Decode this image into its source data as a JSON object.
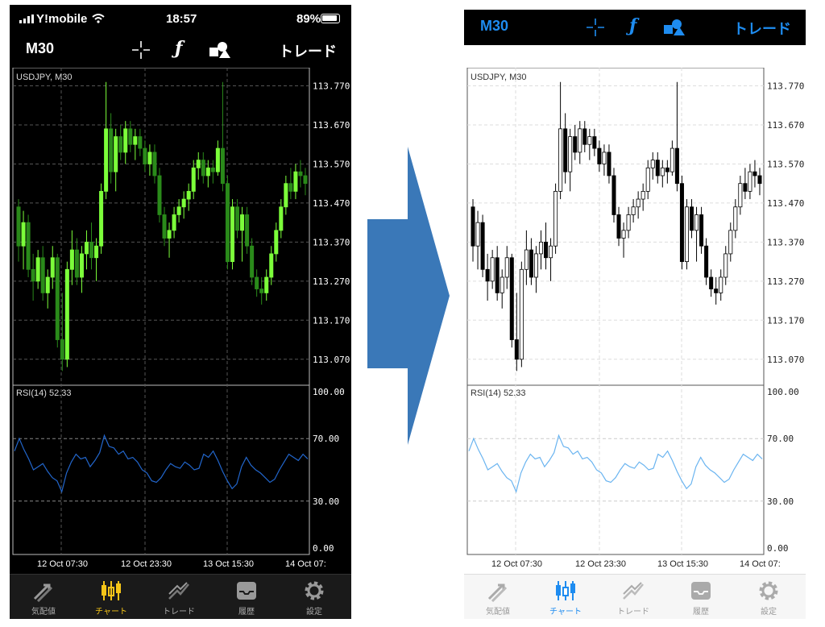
{
  "status": {
    "carrier": "Y!mobile",
    "time": "18:57",
    "battery": "89%"
  },
  "toolbar": {
    "timeframe": "M30",
    "crosshair_icon": "crosshair-icon",
    "indicators_icon": "function-f-icon",
    "objects_icon": "shapes-icon",
    "trade_label": "トレード"
  },
  "chart": {
    "symbol_label": "USDJPY, M30",
    "price_ticks": [
      "113.770",
      "113.670",
      "113.570",
      "113.470",
      "113.370",
      "113.270",
      "113.170",
      "113.070"
    ],
    "rsi_label": "RSI(14) 52.33",
    "rsi_ticks": [
      "100.00",
      "70.00",
      "30.00",
      "0.00"
    ],
    "time_ticks": [
      "12 Oct 07:30",
      "12 Oct 23:30",
      "13 Oct 15:30",
      "14 Oct 07:"
    ]
  },
  "tabs": [
    {
      "label": "気配値",
      "icon": "quotes-arrows-icon"
    },
    {
      "label": "チャート",
      "icon": "candlestick-icon"
    },
    {
      "label": "トレード",
      "icon": "trade-chart-icon"
    },
    {
      "label": "履歴",
      "icon": "history-inbox-icon"
    },
    {
      "label": "設定",
      "icon": "gear-icon"
    }
  ],
  "colors": {
    "dark_bull": "#7cff3a",
    "dark_bear": "#2a8a1a",
    "rsi_dark": "#2266cc",
    "rsi_light": "#6ab4f0",
    "accent_light": "#1e8cf0",
    "tab_active_dark": "#f5c518",
    "arrow": "#3a78b8"
  },
  "chart_data": {
    "type": "candlestick",
    "ylim": [
      113.02,
      113.8
    ],
    "candles": [
      [
        113.46,
        113.48,
        113.32,
        113.36
      ],
      [
        113.36,
        113.45,
        113.3,
        113.42
      ],
      [
        113.42,
        113.44,
        113.28,
        113.3
      ],
      [
        113.3,
        113.34,
        113.22,
        113.27
      ],
      [
        113.27,
        113.35,
        113.25,
        113.33
      ],
      [
        113.33,
        113.36,
        113.22,
        113.24
      ],
      [
        113.24,
        113.3,
        113.2,
        113.28
      ],
      [
        113.28,
        113.36,
        113.25,
        113.33
      ],
      [
        113.33,
        113.34,
        113.1,
        113.12
      ],
      [
        113.12,
        113.24,
        113.04,
        113.07
      ],
      [
        113.07,
        113.32,
        113.05,
        113.3
      ],
      [
        113.3,
        113.4,
        113.26,
        113.35
      ],
      [
        113.35,
        113.38,
        113.26,
        113.28
      ],
      [
        113.28,
        113.36,
        113.24,
        113.34
      ],
      [
        113.34,
        113.4,
        113.3,
        113.37
      ],
      [
        113.37,
        113.42,
        113.3,
        113.33
      ],
      [
        113.33,
        113.38,
        113.27,
        113.36
      ],
      [
        113.36,
        113.52,
        113.34,
        113.5
      ],
      [
        113.5,
        113.78,
        113.48,
        113.66
      ],
      [
        113.66,
        113.7,
        113.52,
        113.55
      ],
      [
        113.55,
        113.66,
        113.5,
        113.64
      ],
      [
        113.64,
        113.67,
        113.58,
        113.6
      ],
      [
        113.6,
        113.68,
        113.57,
        113.66
      ],
      [
        113.66,
        113.68,
        113.6,
        113.62
      ],
      [
        113.62,
        113.66,
        113.58,
        113.64
      ],
      [
        113.64,
        113.66,
        113.59,
        113.61
      ],
      [
        113.61,
        113.63,
        113.55,
        113.57
      ],
      [
        113.57,
        113.62,
        113.54,
        113.6
      ],
      [
        113.6,
        113.62,
        113.52,
        113.54
      ],
      [
        113.54,
        113.56,
        113.42,
        113.44
      ],
      [
        113.44,
        113.46,
        113.36,
        113.38
      ],
      [
        113.38,
        113.42,
        113.33,
        113.4
      ],
      [
        113.4,
        113.46,
        113.38,
        113.44
      ],
      [
        113.44,
        113.48,
        113.42,
        113.46
      ],
      [
        113.46,
        113.5,
        113.43,
        113.48
      ],
      [
        113.48,
        113.52,
        113.45,
        113.5
      ],
      [
        113.5,
        113.58,
        113.48,
        113.56
      ],
      [
        113.56,
        113.6,
        113.53,
        113.58
      ],
      [
        113.58,
        113.6,
        113.52,
        113.54
      ],
      [
        113.54,
        113.58,
        113.51,
        113.56
      ],
      [
        113.56,
        113.58,
        113.52,
        113.55
      ],
      [
        113.55,
        113.63,
        113.54,
        113.61
      ],
      [
        113.61,
        113.78,
        113.5,
        113.52
      ],
      [
        113.52,
        113.54,
        113.3,
        113.32
      ],
      [
        113.32,
        113.48,
        113.3,
        113.46
      ],
      [
        113.46,
        113.48,
        113.38,
        113.4
      ],
      [
        113.4,
        113.46,
        113.32,
        113.44
      ],
      [
        113.44,
        113.46,
        113.34,
        113.36
      ],
      [
        113.36,
        113.38,
        113.26,
        113.28
      ],
      [
        113.28,
        113.3,
        113.23,
        113.25
      ],
      [
        113.25,
        113.28,
        113.21,
        113.24
      ],
      [
        113.24,
        113.3,
        113.22,
        113.28
      ],
      [
        113.28,
        113.36,
        113.26,
        113.34
      ],
      [
        113.34,
        113.42,
        113.32,
        113.4
      ],
      [
        113.4,
        113.48,
        113.38,
        113.46
      ],
      [
        113.46,
        113.54,
        113.44,
        113.52
      ],
      [
        113.52,
        113.56,
        113.48,
        113.5
      ],
      [
        113.5,
        113.57,
        113.48,
        113.55
      ],
      [
        113.55,
        113.58,
        113.51,
        113.54
      ],
      [
        113.54,
        113.56,
        113.49,
        113.52
      ]
    ],
    "rsi": [
      62,
      70,
      63,
      57,
      50,
      52,
      54,
      49,
      45,
      43,
      36,
      48,
      55,
      60,
      57,
      58,
      52,
      56,
      61,
      72,
      65,
      64,
      60,
      62,
      57,
      58,
      55,
      50,
      48,
      43,
      42,
      45,
      50,
      54,
      52,
      51,
      55,
      53,
      50,
      51,
      60,
      58,
      62,
      56,
      49,
      43,
      38,
      41,
      52,
      58,
      53,
      50,
      48,
      45,
      42,
      44,
      50,
      55,
      60,
      58,
      56,
      60,
      57
    ],
    "rsi_ylim": [
      0,
      100
    ]
  }
}
